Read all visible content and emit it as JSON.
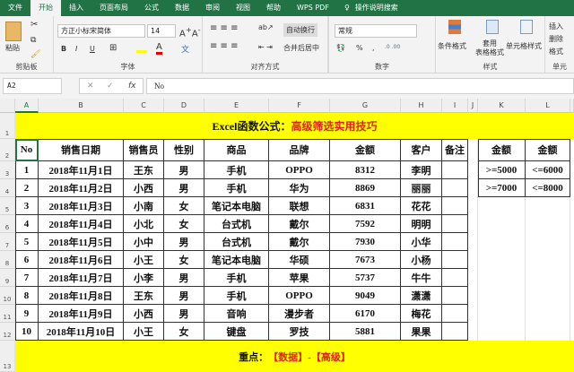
{
  "ribbon_tabs": [
    "文件",
    "开始",
    "插入",
    "页面布局",
    "公式",
    "数据",
    "审阅",
    "视图",
    "帮助",
    "WPS PDF",
    "操作说明搜索"
  ],
  "active_tab": "开始",
  "ribbon": {
    "clipboard": {
      "paste": "粘贴",
      "label": "剪贴板"
    },
    "font": {
      "name": "方正小标宋简体",
      "size": "14",
      "label": "字体",
      "bold": "B",
      "italic": "I",
      "underline": "U"
    },
    "alignment": {
      "wrap": "自动换行",
      "merge": "合并后居中",
      "label": "对齐方式"
    },
    "number": {
      "format": "常规",
      "percent": "%",
      "comma": ",",
      "label": "数字"
    },
    "styles": {
      "conditional": "条件格式",
      "table": "套用\n表格格式",
      "cell": "单元格样式",
      "label": "样式"
    },
    "cells": {
      "insert": "插入",
      "delete": "删除",
      "format": "格式",
      "label": "单元"
    }
  },
  "formula_bar": {
    "name_box": "A2",
    "fx": "fx",
    "value": "No"
  },
  "columns": [
    "A",
    "B",
    "C",
    "D",
    "E",
    "F",
    "G",
    "H",
    "I",
    "J",
    "K",
    "L"
  ],
  "rows": [
    "1",
    "2",
    "3",
    "4",
    "5",
    "6",
    "7",
    "8",
    "9",
    "10",
    "11",
    "12",
    "13"
  ],
  "sheet": {
    "title_black": "Excel函数公式：",
    "title_red": "高级筛选实用技巧",
    "headers": [
      "No",
      "销售日期",
      "销售员",
      "性别",
      "商品",
      "品牌",
      "金额",
      "客户",
      "备注"
    ],
    "data": [
      [
        "1",
        "2018年11月1日",
        "王东",
        "男",
        "手机",
        "OPPO",
        "8312",
        "李明",
        ""
      ],
      [
        "2",
        "2018年11月2日",
        "小西",
        "男",
        "手机",
        "华为",
        "8869",
        "丽丽",
        ""
      ],
      [
        "3",
        "2018年11月3日",
        "小南",
        "女",
        "笔记本电脑",
        "联想",
        "6831",
        "花花",
        ""
      ],
      [
        "4",
        "2018年11月4日",
        "小北",
        "女",
        "台式机",
        "戴尔",
        "7592",
        "明明",
        ""
      ],
      [
        "5",
        "2018年11月5日",
        "小中",
        "男",
        "台式机",
        "戴尔",
        "7930",
        "小华",
        ""
      ],
      [
        "6",
        "2018年11月6日",
        "小王",
        "女",
        "笔记本电脑",
        "华硕",
        "7673",
        "小杨",
        ""
      ],
      [
        "7",
        "2018年11月7日",
        "小李",
        "男",
        "手机",
        "苹果",
        "5737",
        "牛牛",
        ""
      ],
      [
        "8",
        "2018年11月8日",
        "王东",
        "男",
        "手机",
        "OPPO",
        "9049",
        "潇潇",
        ""
      ],
      [
        "9",
        "2018年11月9日",
        "小西",
        "男",
        "音响",
        "漫步者",
        "6170",
        "梅花",
        ""
      ],
      [
        "10",
        "2018年11月10日",
        "小王",
        "女",
        "键盘",
        "罗技",
        "5881",
        "果果",
        ""
      ]
    ],
    "criteria_headers": [
      "金额",
      "金额"
    ],
    "criteria": [
      [
        ">=5000",
        "<=6000"
      ],
      [
        ">=7000",
        "<=8000"
      ]
    ],
    "footer_black": "重点：",
    "footer_red": "【数据】-【高级】"
  }
}
